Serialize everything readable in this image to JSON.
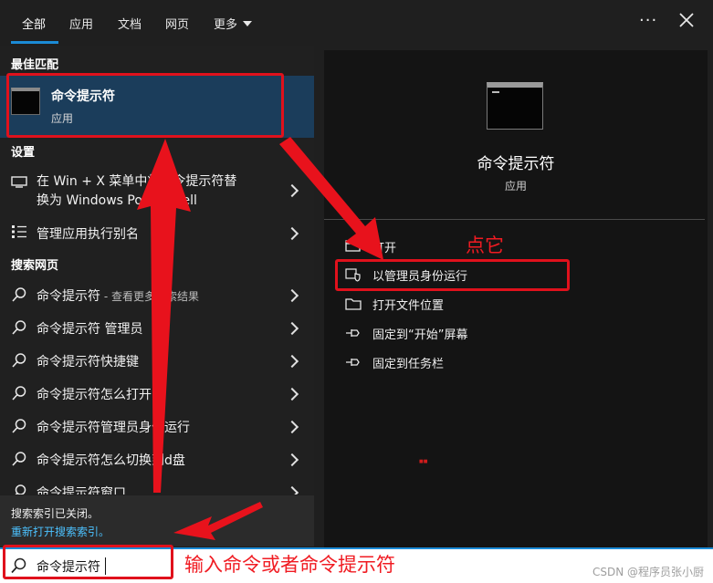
{
  "tabs": [
    "全部",
    "应用",
    "文档",
    "网页",
    "更多"
  ],
  "top_actions": {
    "more_icon": "ellipsis-icon",
    "close_icon": "close-icon"
  },
  "left": {
    "best_match_title": "最佳匹配",
    "best_match": {
      "title": "命令提示符",
      "subtitle": "应用"
    },
    "settings_title": "设置",
    "settings_items": [
      {
        "line1": "在 Win + X 菜单中将命令提示符替",
        "line2": "换为 Windows PowerShell"
      },
      {
        "line1": "管理应用执行别名"
      }
    ],
    "web_title": "搜索网页",
    "web_items": [
      {
        "text": "命令提示符",
        "suffix": " - 查看更多搜索结果"
      },
      {
        "text": "命令提示符 管理员"
      },
      {
        "text": "命令提示符快捷键"
      },
      {
        "text": "命令提示符怎么打开"
      },
      {
        "text": "命令提示符管理员身份运行"
      },
      {
        "text": "命令提示符怎么切换到d盘"
      },
      {
        "text": "命令提示符窗口"
      }
    ],
    "index_off": "搜索索引已关闭。",
    "index_link": "重新打开搜索索引。"
  },
  "right": {
    "title": "命令提示符",
    "subtitle": "应用",
    "actions": [
      {
        "label": "打开",
        "icon": "open-icon"
      },
      {
        "label": "以管理员身份运行",
        "icon": "shield-icon"
      },
      {
        "label": "打开文件位置",
        "icon": "folder-icon"
      },
      {
        "label": "固定到“开始”屏幕",
        "icon": "pin-icon"
      },
      {
        "label": "固定到任务栏",
        "icon": "pin-icon"
      }
    ],
    "tiny_mark": "■■"
  },
  "search": {
    "value": "命令提示符"
  },
  "watermark": "CSDN @程序员张小厨",
  "annotations": {
    "click_it": "点它",
    "input_hint": "输入命令或者命令提示符"
  },
  "colors": {
    "accent": "#1b8bd6",
    "annotation": "#e0111c",
    "link": "#4cc2ff"
  }
}
